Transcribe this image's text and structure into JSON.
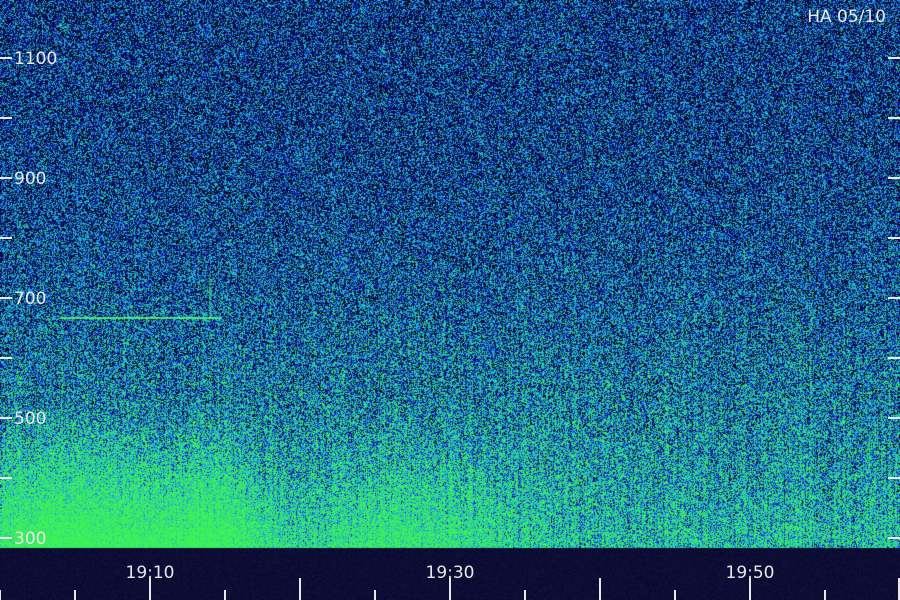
{
  "title": "HA 05/10",
  "chart_data": {
    "type": "heatmap",
    "title": "HA 05/10",
    "xlabel": "",
    "ylabel": "",
    "x_tick_labels": [
      "19:10",
      "19:30",
      "19:50"
    ],
    "y_tick_labels": [
      "1100",
      "900",
      "700",
      "500",
      "300"
    ],
    "ylim": [
      300,
      1100
    ],
    "colors": {
      "background": "#0a0a3c",
      "low": "#1a1ab4",
      "mid": "#2a8cff",
      "high": "#40ff60",
      "axis": "#e8e8e8"
    }
  }
}
